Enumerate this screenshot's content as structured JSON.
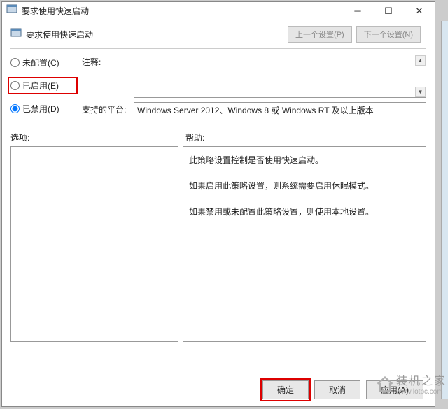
{
  "window": {
    "title": "要求使用快速启动"
  },
  "header": {
    "title": "要求使用快速启动",
    "prev_btn": "上一个设置(P)",
    "next_btn": "下一个设置(N)"
  },
  "radios": {
    "not_configured": "未配置(C)",
    "enabled": "已启用(E)",
    "disabled": "已禁用(D)"
  },
  "fields": {
    "comment_label": "注释:",
    "platform_label": "支持的平台:",
    "platform_value": "Windows Server 2012、Windows 8 或 Windows RT 及以上版本"
  },
  "sections": {
    "options_label": "选项:",
    "help_label": "帮助:"
  },
  "help": {
    "p1": "此策略设置控制是否使用快速启动。",
    "p2": "如果启用此策略设置，则系统需要启用休眠模式。",
    "p3": "如果禁用或未配置此策略设置，则使用本地设置。"
  },
  "buttons": {
    "ok": "确定",
    "cancel": "取消",
    "apply": "应用(A)"
  },
  "watermark": {
    "cn": "装机之家",
    "url": "www.lotpc.com"
  }
}
